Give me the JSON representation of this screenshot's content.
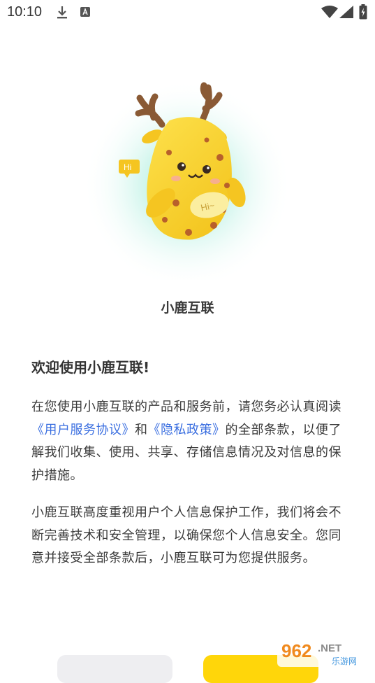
{
  "status_bar": {
    "time": "10:10",
    "icons": [
      "download-icon",
      "a-badge-icon",
      "wifi-icon",
      "signal-icon",
      "battery-icon"
    ]
  },
  "mascot": {
    "bubble_left": "Hi",
    "bubble_belly": "Hi~"
  },
  "app_name": "小鹿互联",
  "dialog": {
    "title": "欢迎使用小鹿互联!",
    "para1": {
      "text_a": "在您使用小鹿互联的产品和服务前，请您务必认真阅读",
      "link_terms": "《用户服务协议》",
      "text_b": "和",
      "link_privacy": "《隐私政策》",
      "text_c": "的全部条款，以便了解我们收集、使用、共享、存储信息情况及对信息的保护措施。"
    },
    "para2": "小鹿互联高度重视用户个人信息保护工作，我们将会不断完善技术和安全管理，以确保您个人信息安全。您同意并接受全部条款后，小鹿互联可为您提供服务。"
  },
  "buttons": {
    "disagree_label": "",
    "agree_label": ""
  },
  "watermark": {
    "brand": "962",
    "suffix": ".NET",
    "sub": "乐游网"
  },
  "colors": {
    "accent": "#ffd60a",
    "link": "#3b6fe0",
    "mascot_yellow": "#f7cf2a",
    "glow": "#7fe6cf"
  }
}
